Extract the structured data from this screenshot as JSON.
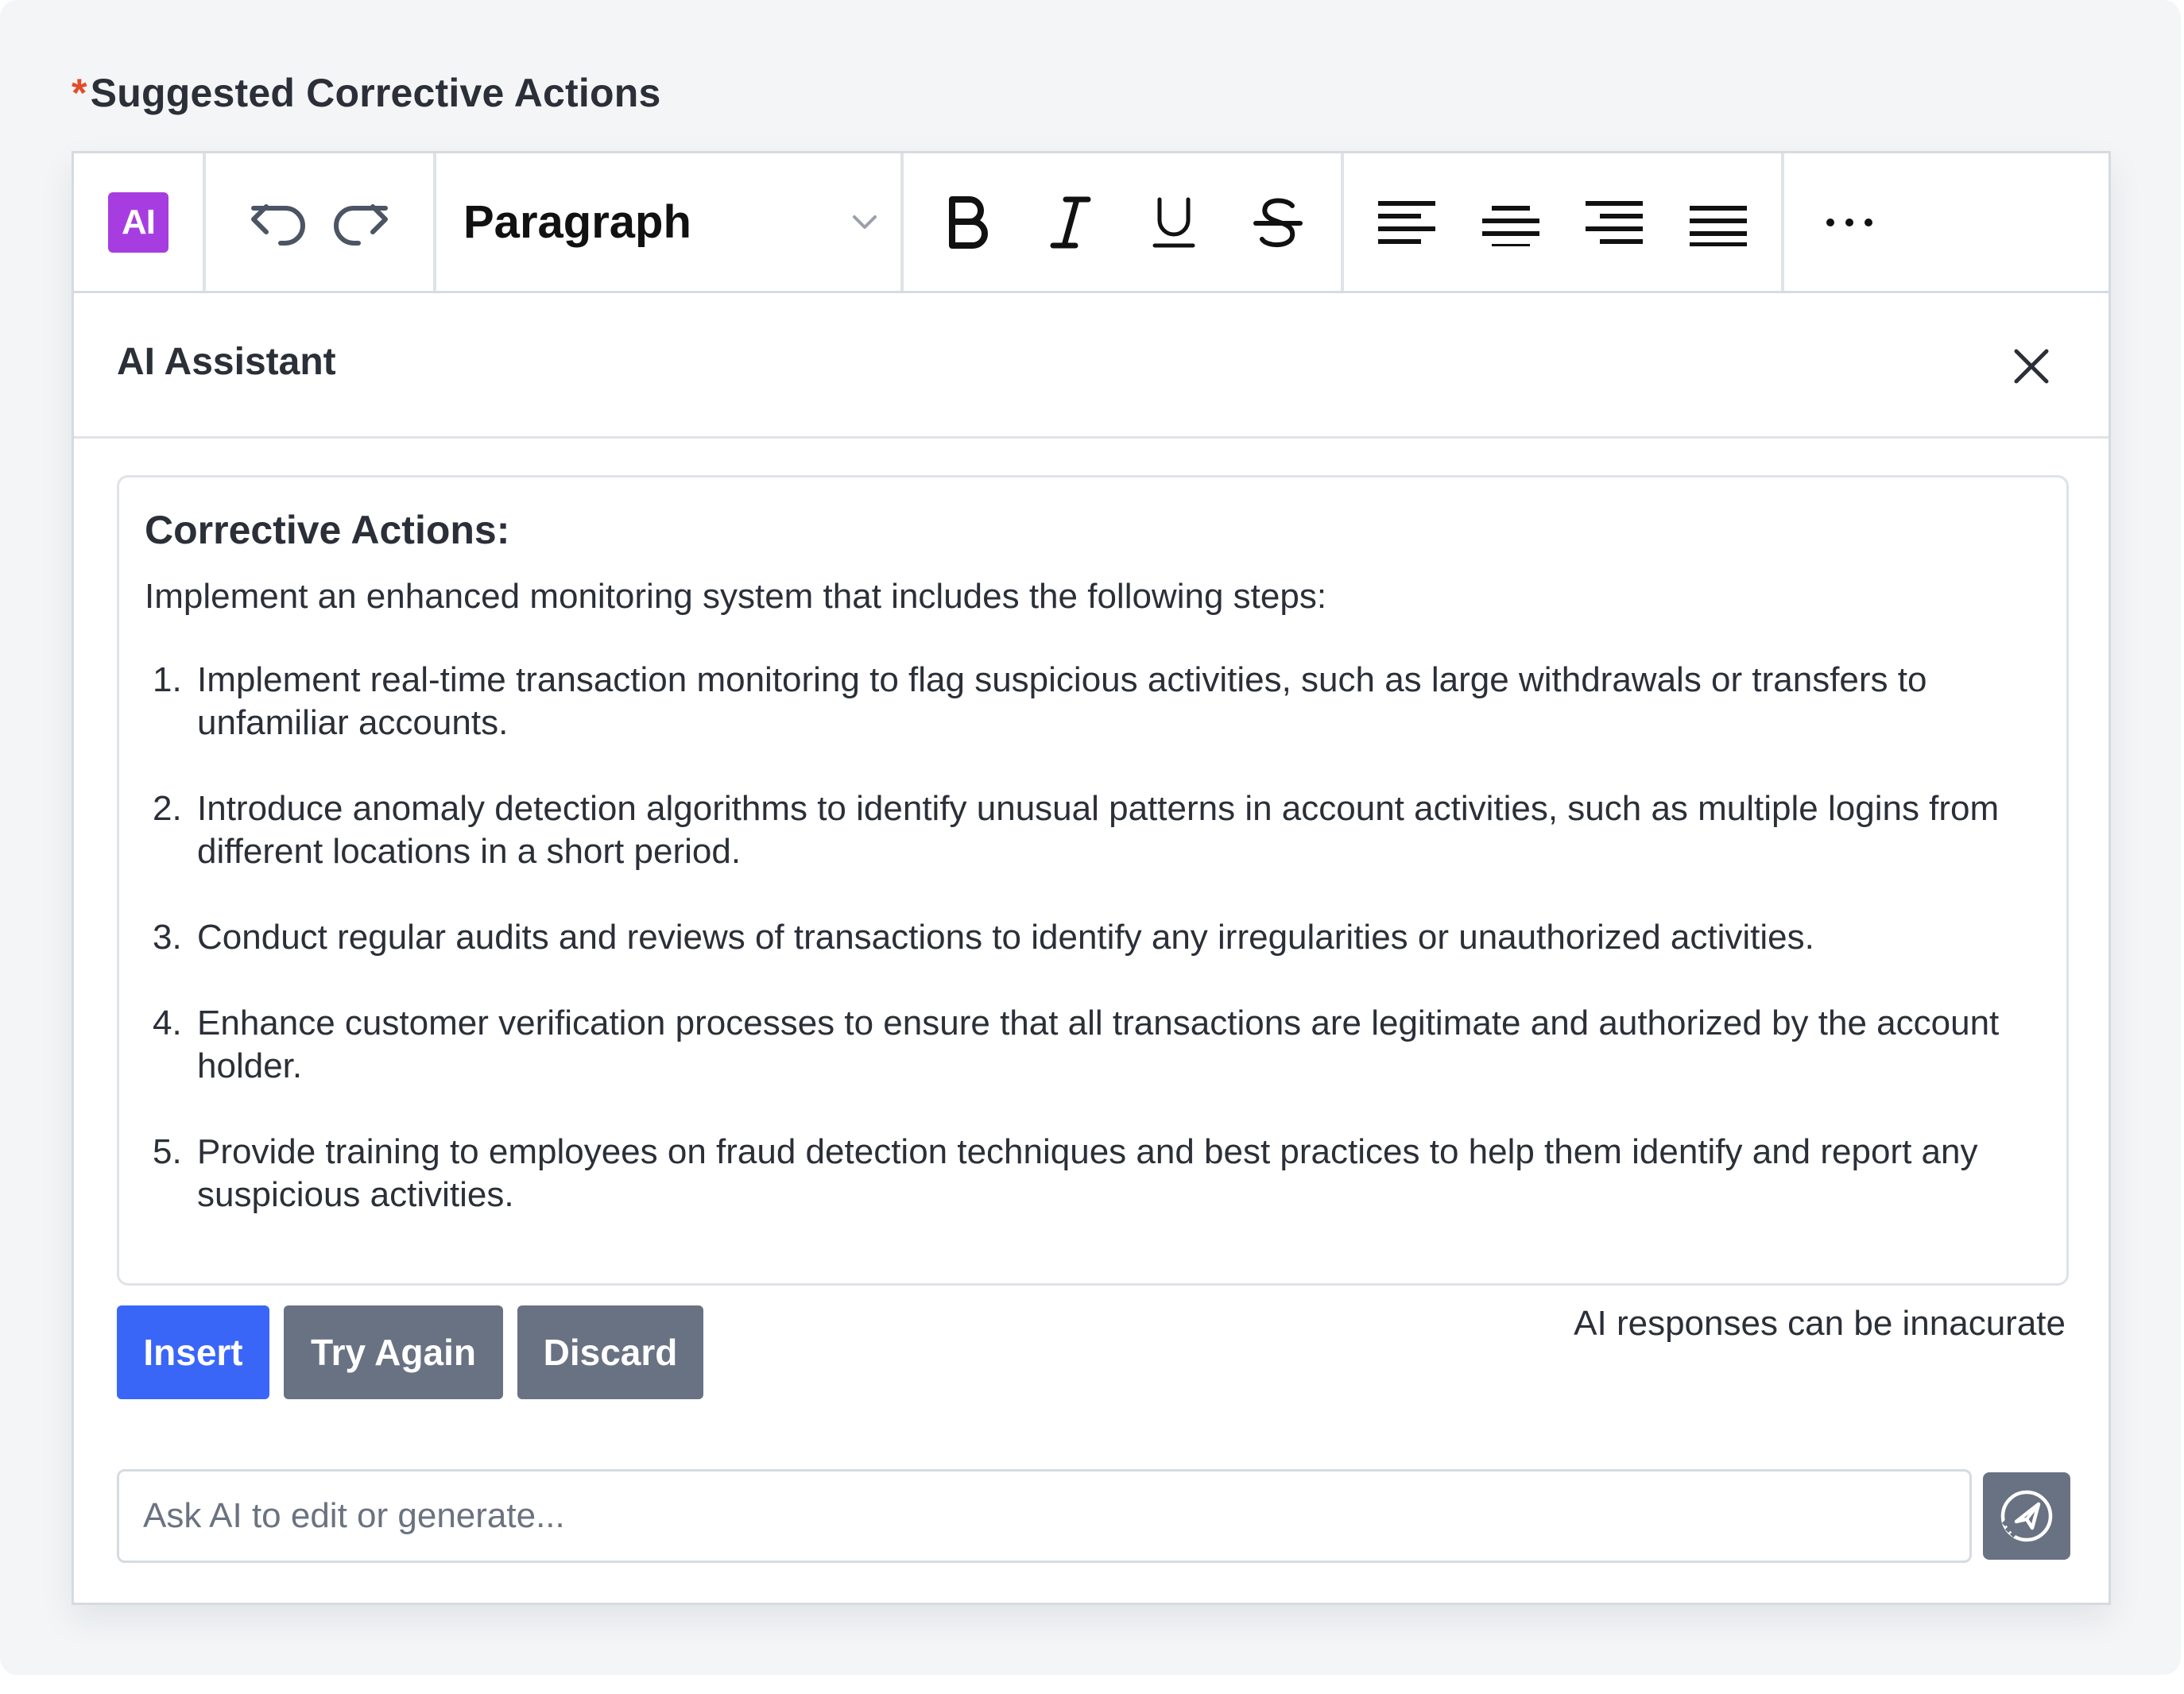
{
  "field": {
    "required_mark": "*",
    "label": "Suggested Corrective Actions"
  },
  "toolbar": {
    "ai_badge": "AI",
    "block_format": "Paragraph",
    "icons": [
      "undo-icon",
      "redo-icon",
      "chevron-down-icon",
      "bold-icon",
      "italic-icon",
      "underline-icon",
      "strikethrough-icon",
      "align-left-icon",
      "align-center-icon",
      "align-right-icon",
      "align-justify-icon",
      "more-icon"
    ]
  },
  "assistant": {
    "title": "AI Assistant",
    "response": {
      "heading": "Corrective Actions:",
      "intro": "Implement an enhanced monitoring system that includes the following steps:",
      "items": [
        {
          "num": "1.",
          "text": "Implement real-time transaction monitoring to flag suspicious activities, such as large withdrawals or transfers to unfamiliar accounts."
        },
        {
          "num": "2.",
          "text": "Introduce anomaly detection algorithms to identify unusual patterns in account activities, such as multiple logins from different locations in a short period."
        },
        {
          "num": "3.",
          "text": "Conduct regular audits and reviews of transactions to identify any irregularities or unauthorized activities."
        },
        {
          "num": "4.",
          "text": "Enhance customer verification processes to ensure that all transactions are legitimate and authorized by the account holder."
        },
        {
          "num": "5.",
          "text": "Provide training to employees on fraud detection techniques and best practices to help them identify and report any suspicious activities."
        }
      ]
    },
    "buttons": {
      "insert": "Insert",
      "try_again": "Try Again",
      "discard": "Discard"
    },
    "disclaimer": "AI responses can be innacurate",
    "prompt_placeholder": "Ask AI to edit or generate...",
    "prompt_value": ""
  },
  "colors": {
    "ai_badge": "#a73de0",
    "primary": "#3a66f7",
    "secondary": "#687283",
    "required": "#e24c2b"
  }
}
